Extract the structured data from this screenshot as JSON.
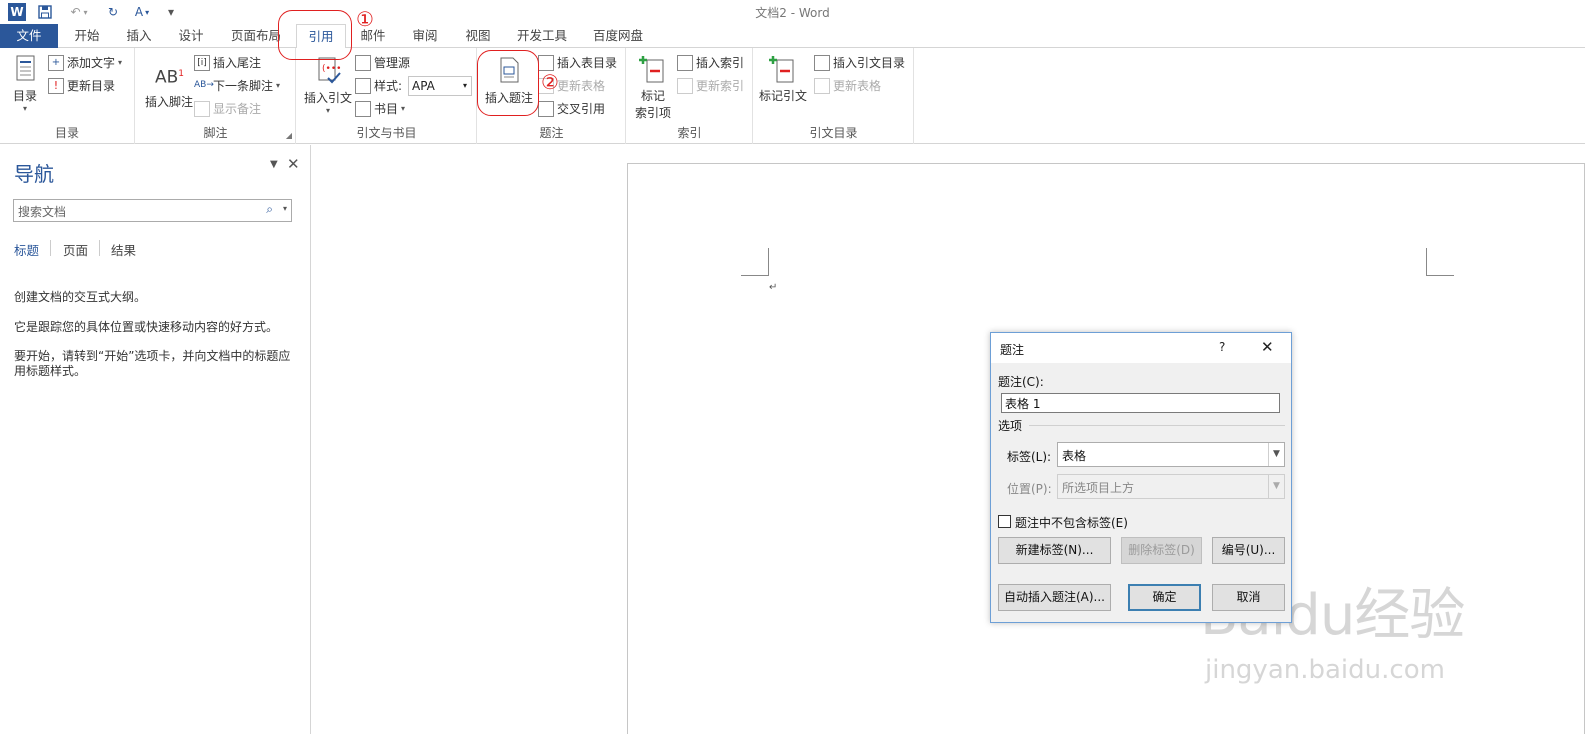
{
  "window": {
    "title": "文档2 - Word"
  },
  "tabs": [
    {
      "label": "文件"
    },
    {
      "label": "开始"
    },
    {
      "label": "插入"
    },
    {
      "label": "设计"
    },
    {
      "label": "页面布局"
    },
    {
      "label": "引用"
    },
    {
      "label": "邮件"
    },
    {
      "label": "审阅"
    },
    {
      "label": "视图"
    },
    {
      "label": "开发工具"
    },
    {
      "label": "百度网盘"
    }
  ],
  "ribbon": {
    "toc": {
      "toc_btn": "目录",
      "add_text": "添加文字",
      "update_toc": "更新目录",
      "group": "目录"
    },
    "footnote": {
      "insert_footnote": "插入脚注",
      "insert_endnote": "插入尾注",
      "next_footnote": "下一条脚注",
      "show_notes": "显示备注",
      "group": "脚注"
    },
    "citation": {
      "insert_citation": "插入引文",
      "manage_sources": "管理源",
      "style_label": "样式:",
      "style_value": "APA",
      "bibliography": "书目",
      "group": "引文与书目"
    },
    "caption": {
      "insert_caption": "插入题注",
      "insert_tof": "插入表目录",
      "update_table": "更新表格",
      "cross_ref": "交叉引用",
      "group": "题注"
    },
    "index": {
      "mark_entry_1": "标记",
      "mark_entry_2": "索引项",
      "insert_index": "插入索引",
      "update_index": "更新索引",
      "group": "索引"
    },
    "toa": {
      "mark_citation": "标记引文",
      "insert_toa": "插入引文目录",
      "update_table": "更新表格",
      "group": "引文目录"
    }
  },
  "annotations": {
    "one": "①",
    "two": "②"
  },
  "nav": {
    "title": "导航",
    "search_placeholder": "搜索文档",
    "tabs": [
      "标题",
      "页面",
      "结果"
    ],
    "p1": "创建文档的交互式大纲。",
    "p2": "它是跟踪您的具体位置或快速移动内容的好方式。",
    "p3": "要开始，请转到“开始”选项卡，并向文档中的标题应用标题样式。"
  },
  "document": {
    "para_mark": "↵"
  },
  "dialog": {
    "title": "题注",
    "help": "?",
    "close": "✕",
    "caption_label": "题注(C):",
    "caption_value": "表格 1",
    "options_label": "选项",
    "label_label": "标签(L):",
    "label_value": "表格",
    "position_label": "位置(P):",
    "position_value": "所选项目上方",
    "exclude_label": "题注中不包含标签(E)",
    "new_label_btn": "新建标签(N)...",
    "delete_label_btn": "删除标签(D)",
    "numbering_btn": "编号(U)...",
    "autocaption_btn": "自动插入题注(A)...",
    "ok_btn": "确定",
    "cancel_btn": "取消"
  },
  "watermark": {
    "brand": "Baidu经验",
    "url": "jingyan.baidu.com"
  }
}
